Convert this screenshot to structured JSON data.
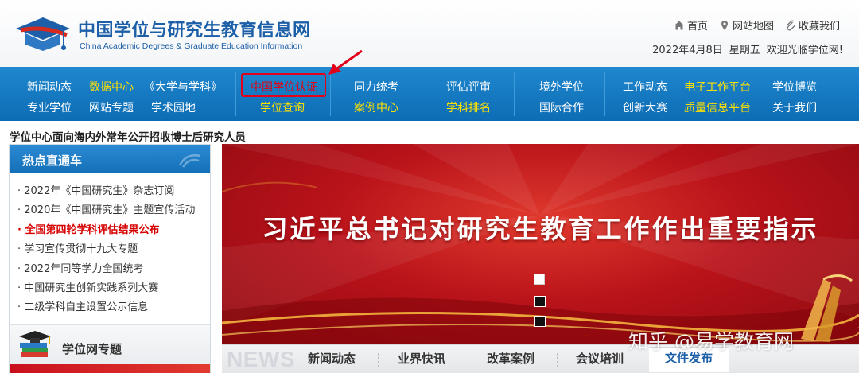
{
  "header": {
    "title": "中国学位与研究生教育信息网",
    "subtitle": "China Academic Degrees & Graduate Education Information",
    "links": [
      {
        "label": "首页",
        "icon": "home-icon"
      },
      {
        "label": "网站地图",
        "icon": "map-pin-icon"
      },
      {
        "label": "收藏我们",
        "icon": "paperclip-icon"
      }
    ],
    "date": "2022年4月8日",
    "weekday": "星期五",
    "welcome": "欢迎光临学位网!"
  },
  "nav": {
    "columns": [
      {
        "row1": [
          {
            "label": "新闻动态",
            "color": "white"
          },
          {
            "label": "数据中心",
            "color": "yellow"
          },
          {
            "label": "《大学与学科》",
            "color": "white"
          }
        ],
        "row2": [
          {
            "label": "专业学位",
            "color": "white"
          },
          {
            "label": "网站专题",
            "color": "white"
          },
          {
            "label": "学术园地",
            "color": "white"
          }
        ]
      },
      {
        "row1": [
          {
            "label": "中国学位认证",
            "color": "red"
          }
        ],
        "row2": [
          {
            "label": "学位查询",
            "color": "yellow"
          }
        ]
      },
      {
        "row1": [
          {
            "label": "同力统考",
            "color": "white"
          }
        ],
        "row2": [
          {
            "label": "案例中心",
            "color": "yellow"
          }
        ]
      },
      {
        "row1": [
          {
            "label": "评估评审",
            "color": "white"
          }
        ],
        "row2": [
          {
            "label": "学科排名",
            "color": "yellow"
          }
        ]
      },
      {
        "row1": [
          {
            "label": "境外学位",
            "color": "white"
          }
        ],
        "row2": [
          {
            "label": "国际合作",
            "color": "white"
          }
        ]
      },
      {
        "row1": [
          {
            "label": "工作动态",
            "color": "white"
          },
          {
            "label": "电子工作平台",
            "color": "yellow"
          },
          {
            "label": "学位博览",
            "color": "white"
          }
        ],
        "row2": [
          {
            "label": "创新大赛",
            "color": "white"
          },
          {
            "label": "质量信息平台",
            "color": "yellow"
          },
          {
            "label": "关于我们",
            "color": "white"
          }
        ]
      }
    ]
  },
  "notice": "学位中心面向海内外常年公开招收博士后研究人员",
  "hot": {
    "title": "热点直通车",
    "items": [
      {
        "label": "· 2022年《中国研究生》杂志订阅",
        "highlight": false
      },
      {
        "label": "· 2020年《中国研究生》主题宣传活动",
        "highlight": false
      },
      {
        "label": "· 全国第四轮学科评估结果公布",
        "highlight": true
      },
      {
        "label": "· 学习宣传贯彻十九大专题",
        "highlight": false
      },
      {
        "label": "· 2022年同等学力全国统考",
        "highlight": false
      },
      {
        "label": "· 中国研究生创新实践系列大赛",
        "highlight": false
      },
      {
        "label": "· 二级学科自主设置公示信息",
        "highlight": false
      }
    ],
    "special_title": "学位网专题"
  },
  "banner": {
    "title": "习近平总书记对研究生教育工作作出重要指示",
    "slide_count": 3,
    "active_slide": 1
  },
  "tabs": {
    "logo": "NEWS",
    "items": [
      "新闻动态",
      "业界快讯",
      "改革案例",
      "会议培训",
      "文件发布"
    ],
    "active": "文件发布"
  },
  "watermark": "知乎 @易学教育网",
  "colors": {
    "brand_blue": "#1c5fa8",
    "nav_blue": "#1478c2",
    "nav_yellow": "#ffe100",
    "highlight_red": "#e3001b",
    "banner_red": "#b8121a"
  }
}
